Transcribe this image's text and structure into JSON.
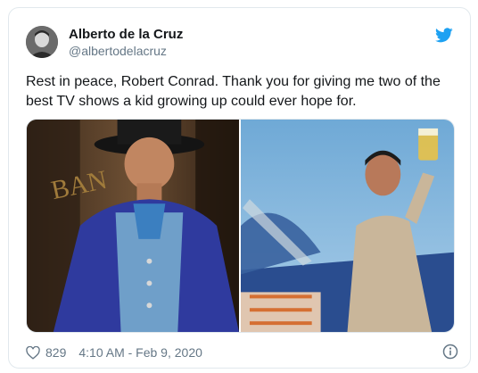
{
  "tweet": {
    "author_name": "Alberto de la Cruz",
    "author_handle": "@albertodelacruz",
    "text": "Rest in peace, Robert Conrad. Thank you for giving me two of the best TV shows a kid growing up could ever hope for.",
    "like_count": "829",
    "timestamp": "4:10 AM - Feb 9, 2020"
  },
  "media": {
    "left_photo": "western-cowboy-blue-suit",
    "right_photo": "pilot-raising-mug-on-plane"
  },
  "icons": {
    "brand": "twitter-bird-icon",
    "like": "heart-icon",
    "info": "info-icon"
  },
  "colors": {
    "brand": "#1da1f2",
    "meta_text": "#657786",
    "border": "#e1e8ed"
  }
}
